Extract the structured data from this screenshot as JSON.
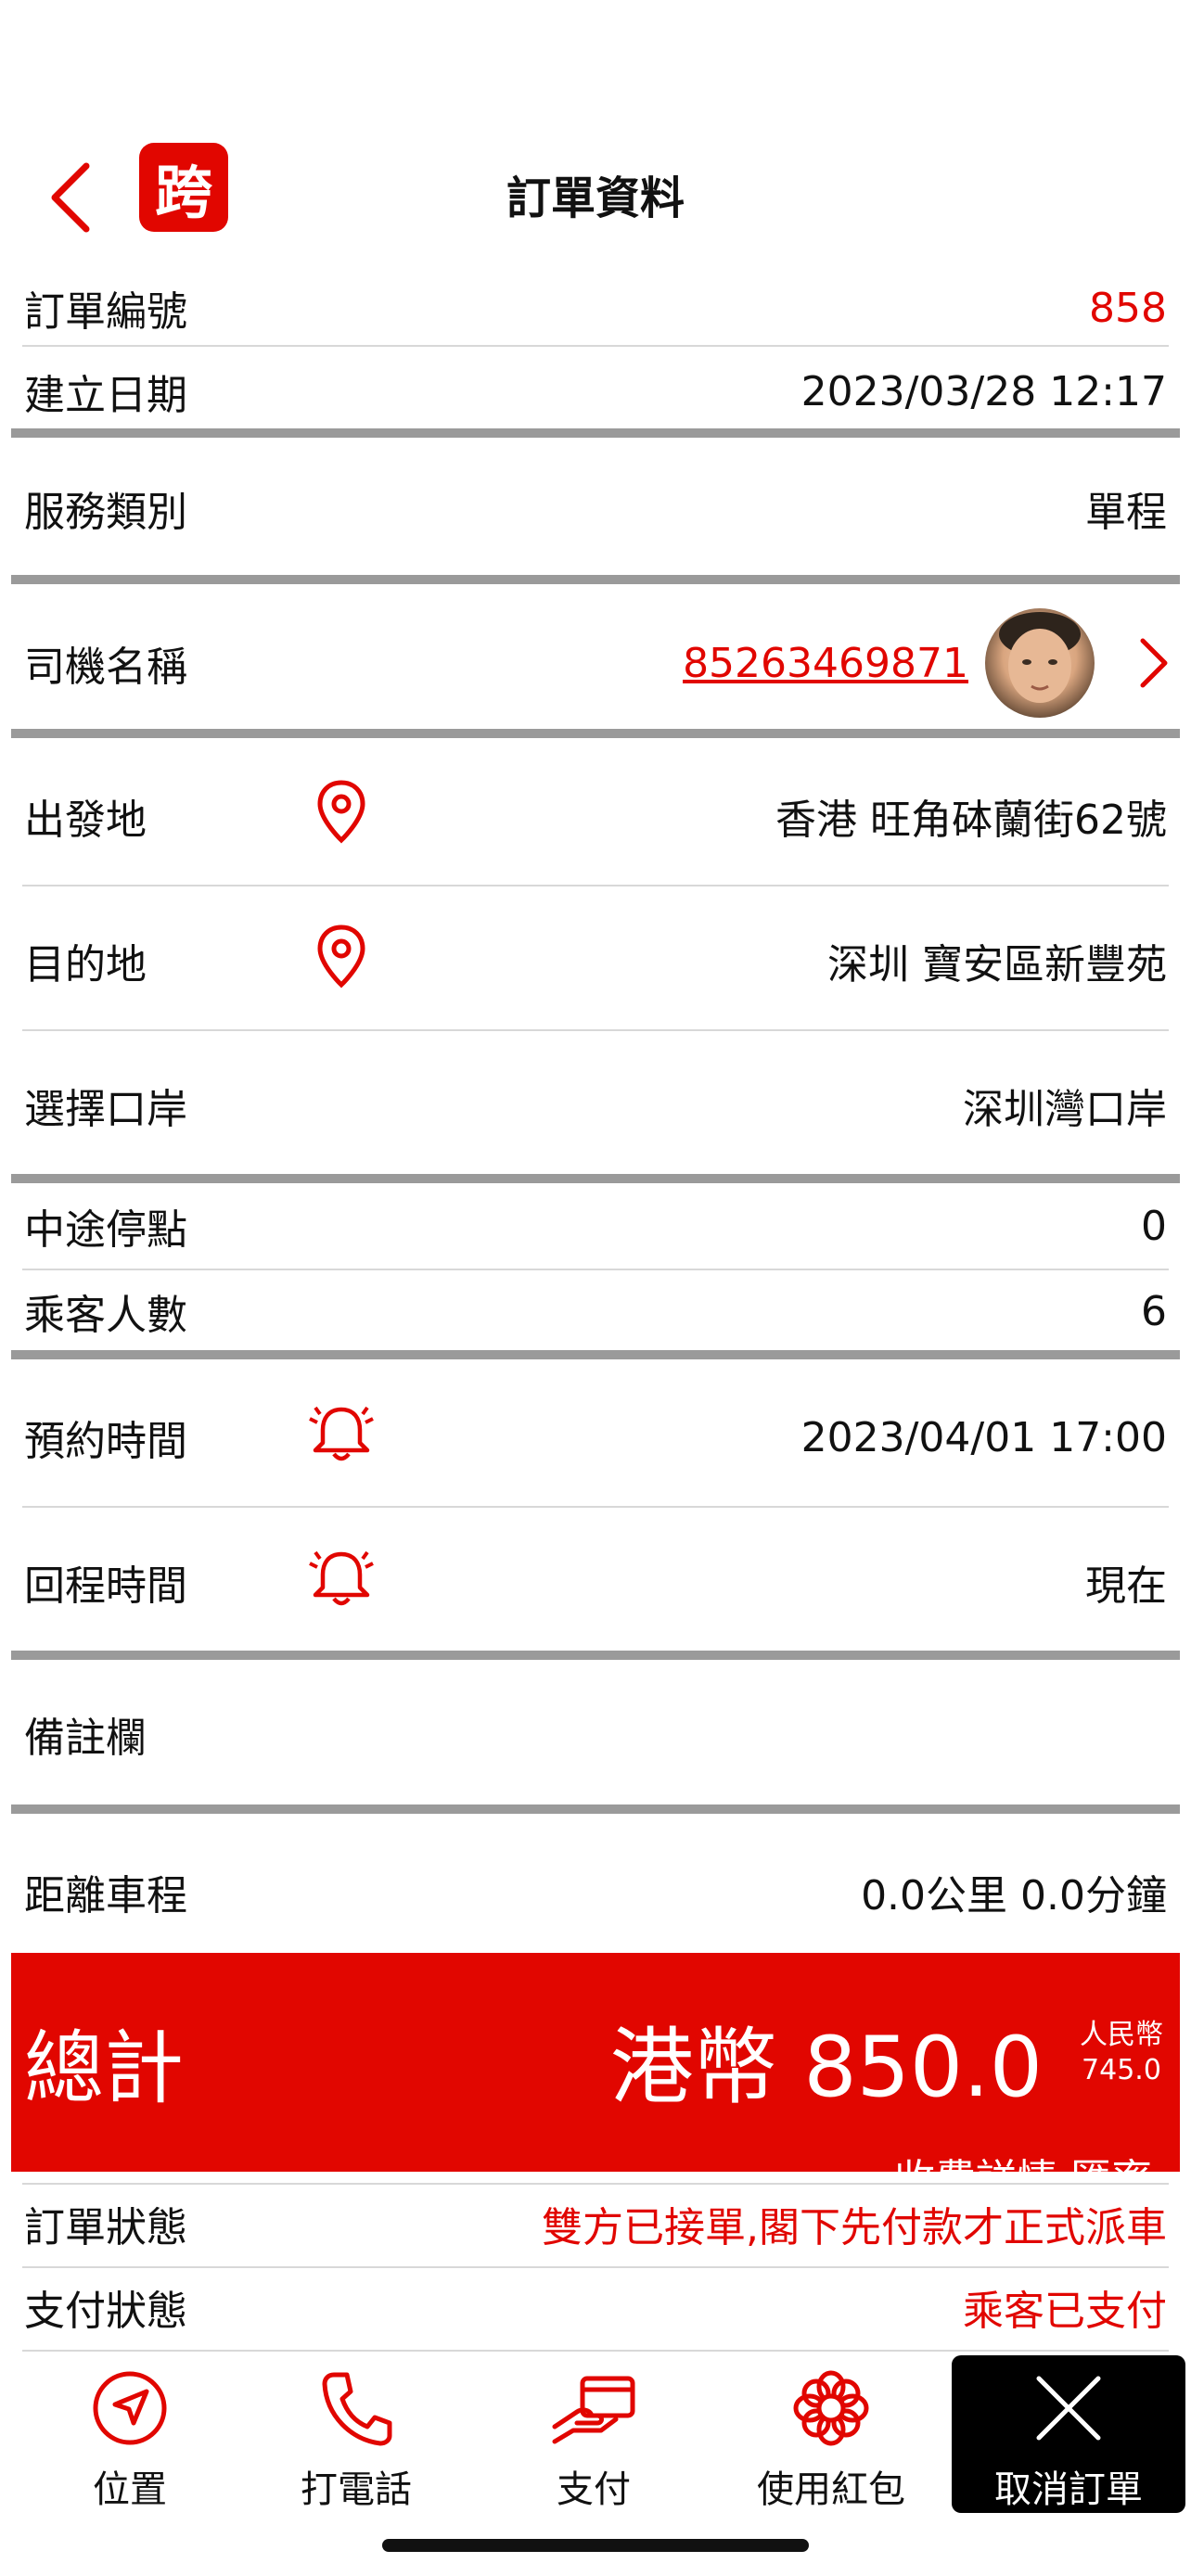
{
  "header": {
    "title": "訂單資料",
    "logo_char": "跨"
  },
  "order": {
    "number_label": "訂單編號",
    "number": "858",
    "created_label": "建立日期",
    "created": "2023/03/28 12:17",
    "service_label": "服務類別",
    "service": "單程",
    "driver_label": "司機名稱",
    "driver_phone": "85263469871",
    "origin_label": "出發地",
    "origin": "香港 旺角砵蘭街62號",
    "destination_label": "目的地",
    "destination": "深圳 寶安區新豐苑",
    "port_label": "選擇口岸",
    "port": "深圳灣口岸",
    "stops_label": "中途停點",
    "stops": "0",
    "passengers_label": "乘客人數",
    "passengers": "6",
    "booking_time_label": "預約時間",
    "booking_time": "2023/04/01 17:00",
    "return_time_label": "回程時間",
    "return_time": "現在",
    "notes_label": "備註欄",
    "distance_label": "距離車程",
    "distance": "0.0公里 0.0分鐘"
  },
  "total": {
    "label": "總計",
    "amount": "港幣 850.0",
    "rmb_label": "人民幣",
    "rmb_amount": "745.0",
    "fee_detail": "收費詳情 匯率"
  },
  "status": {
    "order_status_label": "訂單狀態",
    "order_status": "雙方已接單,閣下先付款才正式派車",
    "payment_status_label": "支付狀態",
    "payment_status": "乘客已支付"
  },
  "tabbar": {
    "location": "位置",
    "call": "打電話",
    "pay": "支付",
    "coupon": "使用紅包",
    "cancel": "取消訂單"
  },
  "colors": {
    "accent": "#e10600",
    "divider": "#9a9a9a"
  },
  "icons": [
    "chevron-left-icon",
    "map-pin-icon",
    "alarm-bell-icon",
    "navigation-icon",
    "phone-icon",
    "payment-card-icon",
    "flower-coupon-icon",
    "close-icon",
    "chevron-right-icon"
  ]
}
